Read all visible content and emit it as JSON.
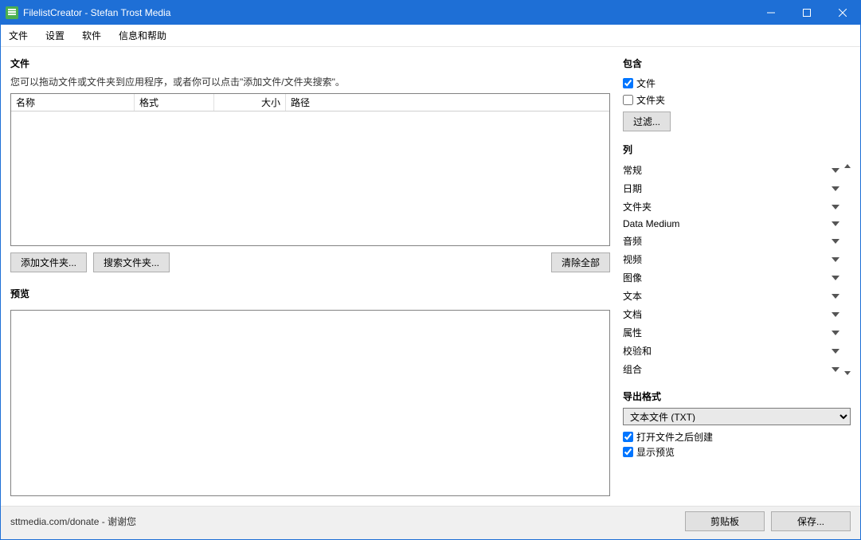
{
  "window": {
    "title": "FilelistCreator - Stefan Trost Media"
  },
  "menu": {
    "file": "文件",
    "settings": "设置",
    "software": "软件",
    "help": "信息和帮助"
  },
  "files": {
    "header": "文件",
    "hint": "您可以拖动文件或文件夹到应用程序，或者你可以点击\"添加文件/文件夹搜索\"。",
    "columns": {
      "name": "名称",
      "format": "格式",
      "size": "大小",
      "path": "路径"
    },
    "add_folder": "添加文件夹...",
    "search_folder": "搜索文件夹...",
    "clear_all": "清除全部"
  },
  "preview": {
    "header": "预览"
  },
  "include": {
    "header": "包含",
    "files_label": "文件",
    "files_checked": true,
    "folders_label": "文件夹",
    "folders_checked": false,
    "filter": "过滤..."
  },
  "columns": {
    "header": "列",
    "items": [
      "常规",
      "日期",
      "文件夹",
      "Data Medium",
      "音频",
      "视频",
      "图像",
      "文本",
      "文档",
      "属性",
      "校验和",
      "组合"
    ]
  },
  "export": {
    "header": "导出格式",
    "format": "文本文件 (TXT)",
    "open_after_label": "打开文件之后创建",
    "open_after_checked": true,
    "show_preview_label": "显示预览",
    "show_preview_checked": true
  },
  "status": {
    "text": "sttmedia.com/donate - 谢谢您",
    "clipboard": "剪贴板",
    "save": "保存..."
  }
}
